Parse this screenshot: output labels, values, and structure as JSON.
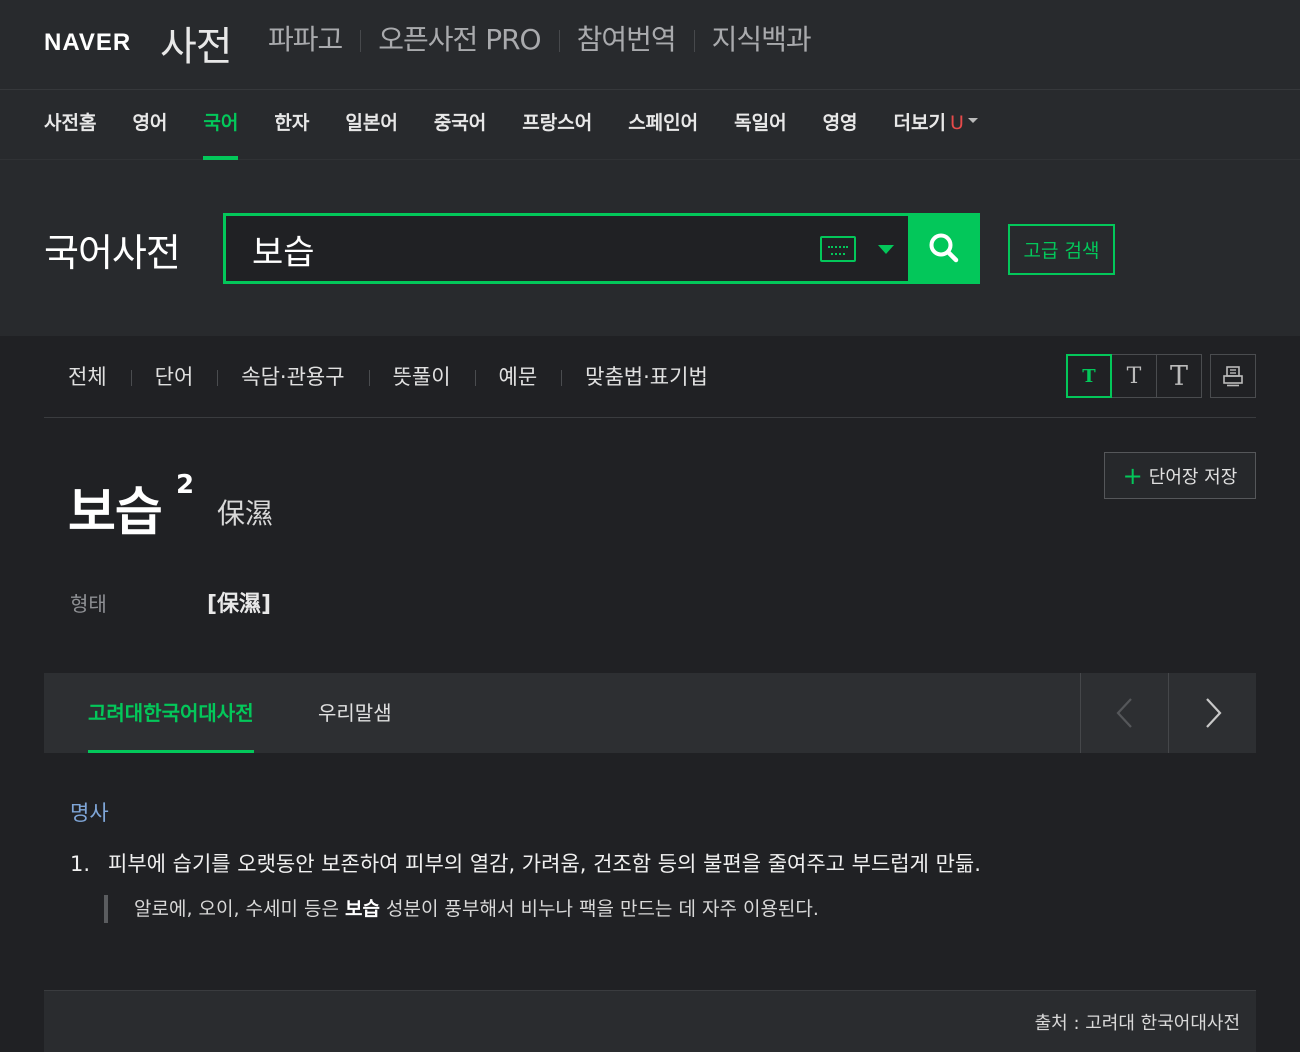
{
  "header": {
    "logo": "NAVER",
    "brand": "사전",
    "services": [
      "파파고",
      "오픈사전 PRO",
      "참여번역",
      "지식백과"
    ]
  },
  "lang_nav": {
    "items": [
      "사전홈",
      "영어",
      "국어",
      "한자",
      "일본어",
      "중국어",
      "프랑스어",
      "스페인어",
      "독일어",
      "영영"
    ],
    "active": "국어",
    "more_label": "더보기",
    "more_mark": "U"
  },
  "search": {
    "title": "국어사전",
    "query": "보습",
    "advanced_label": "고급 검색"
  },
  "result_tabs": [
    "전체",
    "단어",
    "속담·관용구",
    "뜻풀이",
    "예문",
    "맞춤법·표기법"
  ],
  "font_tools": {
    "size_glyph": "T"
  },
  "entry": {
    "word": "보습",
    "superscript": "2",
    "hanja": "保濕",
    "save_label": "단어장 저장",
    "form_label": "형태",
    "form_value": "[保濕]"
  },
  "source_tabs": {
    "items": [
      "고려대한국어대사전",
      "우리말샘"
    ],
    "active": "고려대한국어대사전"
  },
  "meaning": {
    "part_of_speech": "명사",
    "number": "1.",
    "definition": "피부에 습기를 오랫동안 보존하여 피부의 열감, 가려움, 건조함 등의 불편을 줄여주고 부드럽게 만듦.",
    "example_before": "알로에, 오이, 수세미 등은 ",
    "example_bold": "보습",
    "example_after": " 성분이 풍부해서 비누나 팩을 만드는 데 자주 이용된다."
  },
  "footer": {
    "source": "출처 : 고려대 한국어대사전"
  },
  "colors": {
    "accent": "#03c75a",
    "background": "#202124",
    "pos_blue": "#7fa6d8"
  }
}
